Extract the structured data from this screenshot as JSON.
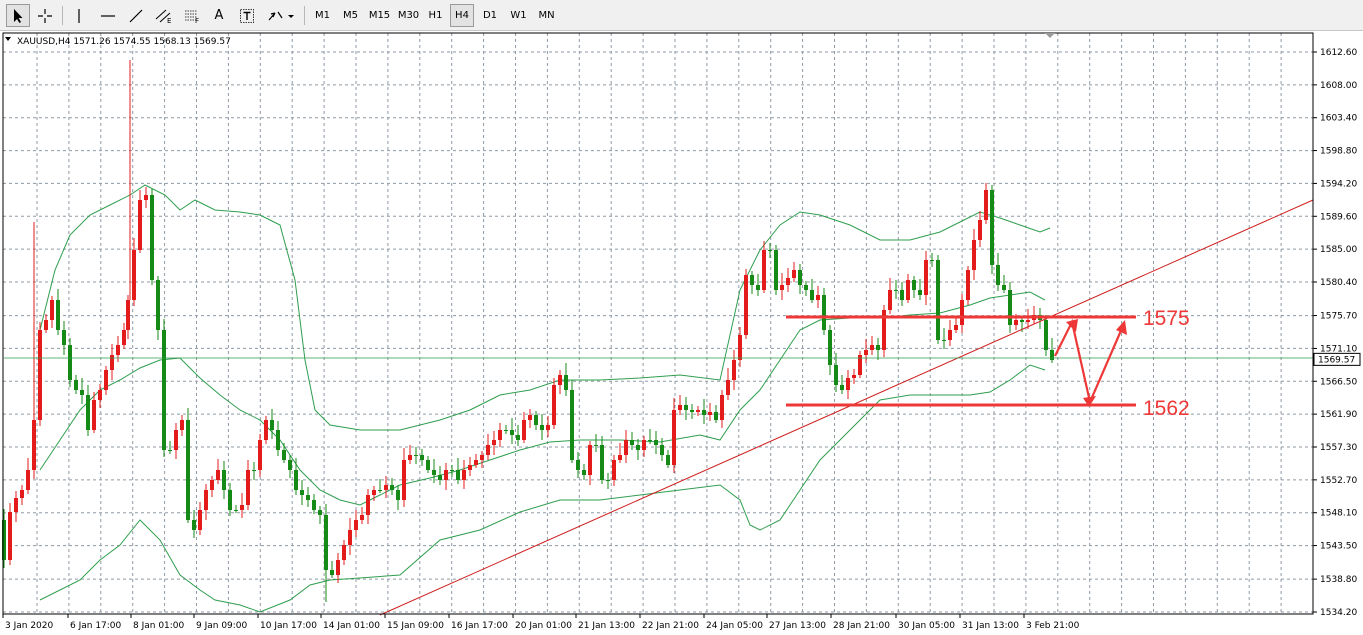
{
  "toolbar": {
    "tools": [
      {
        "name": "cursor-icon"
      },
      {
        "name": "crosshair-icon"
      },
      {
        "name": "vertical-line-icon"
      },
      {
        "name": "horizontal-line-icon"
      },
      {
        "name": "trendline-icon"
      },
      {
        "name": "equidistant-channel-icon"
      },
      {
        "name": "fibonacci-icon"
      },
      {
        "name": "text-icon"
      },
      {
        "name": "text-label-icon"
      },
      {
        "name": "arrows-shapes-icon"
      }
    ],
    "text_tool": "A",
    "timeframes": [
      "M1",
      "M5",
      "M15",
      "M30",
      "H1",
      "H4",
      "D1",
      "W1",
      "MN"
    ],
    "active_timeframe": "H4"
  },
  "chart": {
    "header": "XAUUSD,H4  1571.26 1574.55 1568.13 1569.57",
    "current_price_label": "1569.57",
    "colors": {
      "up": "#e41b1b",
      "down": "#168a16",
      "bollinger": "#2e9e4e",
      "grid": "#8f9aa5",
      "annotation": "#ee3838",
      "trendline": "#d01c1c"
    }
  },
  "chart_data": {
    "type": "candlestick",
    "symbol": "XAUUSD",
    "timeframe": "H4",
    "last_bar": {
      "open": 1571.26,
      "high": 1574.55,
      "low": 1568.13,
      "close": 1569.57
    },
    "y_ticks": [
      "1612.60",
      "1608.00",
      "1603.40",
      "1598.80",
      "1594.20",
      "1589.60",
      "1585.00",
      "1580.40",
      "1575.70",
      "1571.10",
      "1566.50",
      "1561.90",
      "1557.30",
      "1552.70",
      "1548.10",
      "1543.50",
      "1538.80",
      "1534.20"
    ],
    "x_ticks": [
      "3 Jan 2020",
      "6 Jan 17:00",
      "8 Jan 01:00",
      "9 Jan 09:00",
      "10 Jan 17:00",
      "14 Jan 01:00",
      "15 Jan 09:00",
      "16 Jan 17:00",
      "20 Jan 01:00",
      "21 Jan 13:00",
      "22 Jan 21:00",
      "24 Jan 05:00",
      "27 Jan 13:00",
      "28 Jan 21:00",
      "30 Jan 05:00",
      "31 Jan 13:00",
      "3 Feb 21:00"
    ],
    "annotations": {
      "resistance": "1575",
      "support": "1562"
    },
    "grid": true
  }
}
